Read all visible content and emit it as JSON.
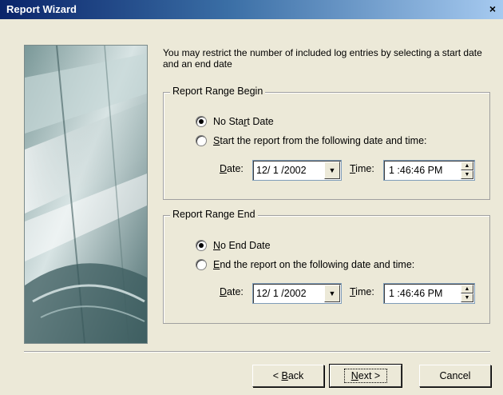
{
  "window": {
    "title": "Report Wizard",
    "close_glyph": "×"
  },
  "intro_text": "You may restrict the number of included log entries by selecting a start date and an end date",
  "begin": {
    "group_label": "Report Range Begin",
    "option_none": {
      "first": "No Sta",
      "underlined": "r",
      "rest": "t Date"
    },
    "option_start": {
      "underlined": "S",
      "rest": "tart the report from the following date and time:"
    },
    "selected": "none",
    "date_label": {
      "underlined": "D",
      "rest": "ate:"
    },
    "date_value": "12/ 1 /2002",
    "time_label": {
      "underlined": "T",
      "rest": "ime:"
    },
    "time_value": "1 :46:46 PM"
  },
  "end": {
    "group_label": "Report Range End",
    "option_none": {
      "underlined": "N",
      "rest": "o End Date"
    },
    "option_end": {
      "underlined": "E",
      "rest": "nd the report on the following date and time:"
    },
    "selected": "none",
    "date_label": {
      "underlined": "D",
      "rest": "ate:"
    },
    "date_value": "12/ 1 /2002",
    "time_label": {
      "underlined": "T",
      "rest": "ime:"
    },
    "time_value": "1 :46:46 PM"
  },
  "buttons": {
    "back": {
      "prefix": "< ",
      "underlined": "B",
      "rest": "ack"
    },
    "next": {
      "underlined": "N",
      "rest": "ext >"
    },
    "cancel": "Cancel"
  },
  "colors": {
    "titlebar_start": "#0a246a",
    "titlebar_end": "#a6caf0",
    "dialog_bg": "#ece9d8"
  },
  "icons": {
    "close": "close-icon",
    "dropdown": "chevron-down-icon",
    "spin_up": "spin-up-icon",
    "spin_down": "spin-down-icon",
    "side_image": "wizard-decorative-image"
  }
}
